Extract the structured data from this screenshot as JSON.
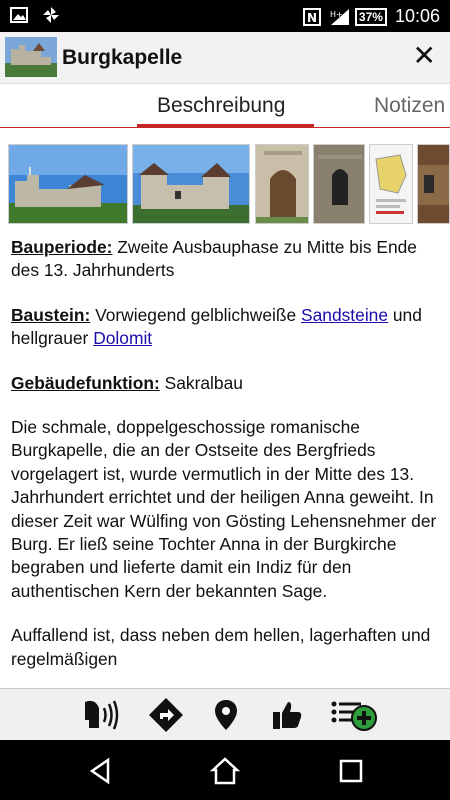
{
  "status_bar": {
    "battery": "37%",
    "time": "10:06",
    "icons": [
      "image-icon",
      "pinwheel-icon",
      "nfc-icon",
      "signal-icon"
    ]
  },
  "header": {
    "title": "Burgkapelle",
    "close_label": "✕"
  },
  "tabs": [
    {
      "label": "Beschreibung",
      "active": true
    },
    {
      "label": "Notizen",
      "active": false
    }
  ],
  "gallery": [
    "castle-photo-1",
    "castle-photo-2",
    "chapel-door-photo",
    "chapel-window-photo",
    "floorplan-photo",
    "castle-photo-3"
  ],
  "content": {
    "bauperiode": {
      "label": "Bauperiode:",
      "text": " Zweite Ausbauphase zu Mitte bis Ende des 13. Jahrhunderts"
    },
    "baustein": {
      "label": "Baustein:",
      "text1": " Vorwiegend gelblichweiße ",
      "link1": "Sandsteine",
      "text2": " und hellgrauer ",
      "link2": "Dolomit"
    },
    "gebaeudefunktion": {
      "label": "Gebäudefunktion:",
      "text": " Sakralbau"
    },
    "paragraph1": "Die schmale, doppelgeschossige romanische Burgkapelle, die an der Ostseite des Bergfrieds vorgelagert ist, wurde vermutlich in der Mitte des 13. Jahrhundert errichtet und der heiligen Anna geweiht. In dieser Zeit war Wülfing von Gösting Lehensnehmer der Burg. Er ließ seine Tochter Anna in der Burgkirche begraben und lieferte damit ein Indiz für den authentischen Kern der bekannten Sage.",
    "paragraph2": "Auffallend ist, dass neben dem hellen, lagerhaften und regelmäßigen"
  },
  "toolbar": [
    "speak-icon",
    "directions-icon",
    "location-pin-icon",
    "thumbs-up-icon",
    "add-to-list-icon"
  ],
  "colors": {
    "accent": "#c62828",
    "link": "#1a0dab",
    "add_green": "#2e9e3c"
  }
}
